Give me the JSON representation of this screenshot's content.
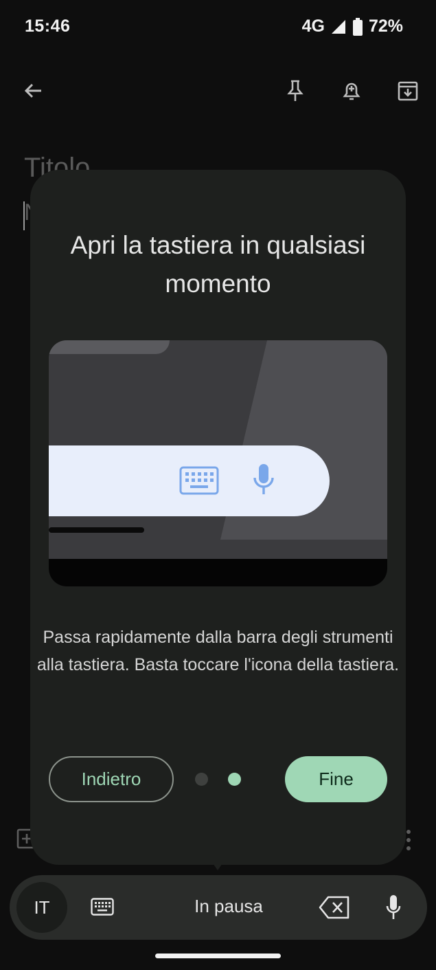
{
  "status_bar": {
    "time": "15:46",
    "network": "4G",
    "battery": "72%"
  },
  "note": {
    "title_placeholder": "Titolo",
    "body_placeholder": "N"
  },
  "dialog": {
    "title": "Apri la tastiera in qualsiasi momento",
    "description": "Passa rapidamente dalla barra degli strumenti alla tastiera. Basta toccare l'icona della tastiera.",
    "back_label": "Indietro",
    "done_label": "Fine",
    "page_indicator": {
      "total": 2,
      "current": 2
    }
  },
  "toolbar": {
    "language": "IT",
    "status": "In pausa"
  },
  "colors": {
    "accent": "#9fd7b5",
    "dialog_bg": "#1e201e",
    "toolbar_bg": "#2a2c2a",
    "keyboard_icon": "#7aa7ea"
  },
  "icons": {
    "app_bar": [
      "back-arrow-icon",
      "pin-icon",
      "reminder-bell-icon",
      "archive-icon"
    ],
    "illustration": [
      "keyboard-icon",
      "mic-icon"
    ],
    "toolbar": [
      "keyboard-icon",
      "backspace-icon",
      "mic-icon"
    ]
  }
}
